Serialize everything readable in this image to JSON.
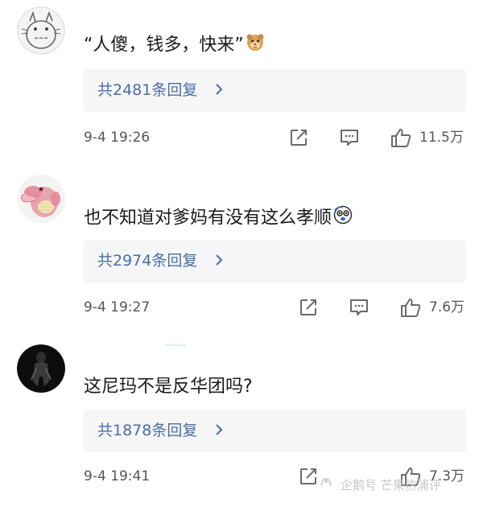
{
  "comments": [
    {
      "text": "“人傻，钱多，快来”",
      "emoji_name": "hamster-emoji",
      "replies_label": "共2481条回复",
      "timestamp": "9-4 19:26",
      "likes": "11.5万"
    },
    {
      "text": "也不知道对爹妈有没有这么孝顺",
      "emoji_name": "surprised-face-emoji",
      "replies_label": "共2974条回复",
      "timestamp": "9-4 19:27",
      "likes": "7.6万"
    },
    {
      "text": "这尼玛不是反华团吗?",
      "replies_label": "共1878条回复",
      "timestamp": "9-4 19:41",
      "likes": "7.3万"
    }
  ],
  "watermark": {
    "text": "企鹅号 芒果热浦评"
  },
  "colors": {
    "reply_link": "#4a6da8",
    "reply_box_bg": "#f6f6f6",
    "meta_text": "#555555",
    "icon_stroke": "#6b6b6b"
  }
}
